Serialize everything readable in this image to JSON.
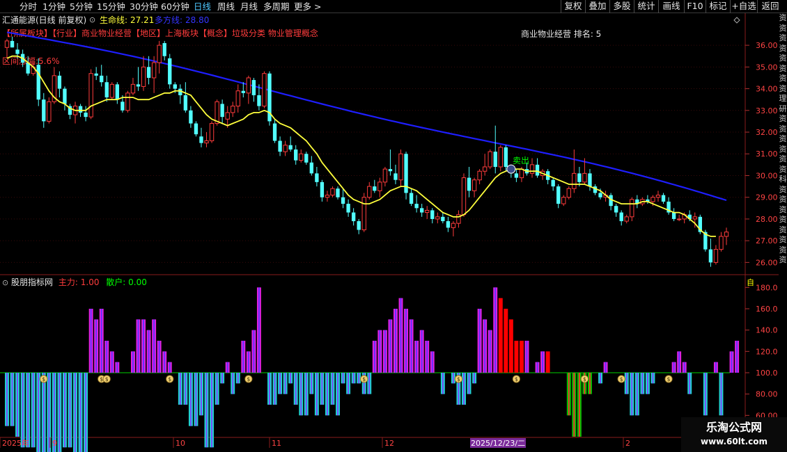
{
  "toolbar": {
    "periods": [
      {
        "label": "分时"
      },
      {
        "label": "1分钟"
      },
      {
        "label": "5分钟"
      },
      {
        "label": "15分钟"
      },
      {
        "label": "30分钟"
      },
      {
        "label": "60分钟"
      },
      {
        "label": "日线",
        "active": true
      },
      {
        "label": "周线"
      },
      {
        "label": "月线"
      },
      {
        "label": "多周期"
      },
      {
        "label": "更多 >"
      }
    ],
    "right_buttons": [
      "复权",
      "叠加",
      "多股",
      "统计",
      "画线",
      "F10",
      "标记",
      "+自选",
      "返回"
    ]
  },
  "main_panel": {
    "title": "汇通能源(日线 前复权)",
    "life_line_label": "生命线:",
    "life_line_value": "27.21",
    "bull_line_label": "多方线:",
    "bull_line_value": "28.80",
    "tags_line": "【所属板块】【行业】商业物业经营【地区】上海板块【概念】垃圾分类 物业管理概念",
    "pct_text": "区间涨幅:5.6%",
    "sector_rank": "商业物业经营 排名: 5",
    "sell_label": "卖出",
    "y_ticks": [
      "36.00",
      "35.00",
      "34.00",
      "33.00",
      "32.00",
      "31.00",
      "30.00",
      "29.00",
      "28.00",
      "27.00",
      "26.00"
    ]
  },
  "sub_panel": {
    "title": "股朋指标网",
    "main_force_label": "主力: 1.00",
    "retail_label": "散户: 0.00",
    "y_ticks": [
      "180.0",
      "160.0",
      "140.0",
      "120.0",
      "100.0",
      "80.00",
      "60.00"
    ],
    "yellow_marker": "自"
  },
  "x_axis": {
    "labels": [
      "2025年",
      "9",
      "10",
      "11",
      "12",
      "2025/12/23/二",
      "2"
    ]
  },
  "right_strip_text": "资资资资资资资资理研资资资资资资科资资资资资资资资",
  "watermark": {
    "title": "乐淘公式网",
    "url": "www.60lt.com"
  },
  "colors": {
    "up": "#ff3c3c",
    "down": "#52ffff",
    "life_line": "#ffff3c",
    "bull_line": "#1e1eff",
    "bar_magenta": "#e020e0",
    "bar_red": "#ff0000",
    "bar_cyan": "#20d0d0",
    "bar_green": "#00c000"
  },
  "chart_data": {
    "type": "candlestick",
    "ylim": [
      25.5,
      36.9
    ],
    "candles": [
      [
        35.9,
        36.3,
        35.4,
        36.2
      ],
      [
        36.2,
        36.4,
        35.9,
        35.9
      ],
      [
        35.8,
        36.1,
        35.4,
        35.6
      ],
      [
        35.6,
        35.8,
        35.0,
        35.2
      ],
      [
        35.2,
        35.5,
        34.6,
        34.7
      ],
      [
        34.7,
        35.2,
        34.6,
        35.0
      ],
      [
        35.1,
        35.4,
        33.2,
        33.5
      ],
      [
        33.5,
        33.8,
        32.2,
        32.5
      ],
      [
        32.5,
        33.6,
        32.4,
        33.4
      ],
      [
        33.4,
        35.0,
        33.3,
        34.6
      ],
      [
        34.6,
        34.8,
        33.6,
        34.0
      ],
      [
        34.0,
        34.1,
        33.0,
        33.3
      ],
      [
        33.2,
        33.3,
        32.6,
        32.8
      ],
      [
        32.8,
        33.4,
        32.4,
        33.2
      ],
      [
        33.2,
        33.3,
        32.7,
        32.9
      ],
      [
        32.9,
        33.2,
        32.5,
        32.7
      ],
      [
        32.7,
        34.9,
        32.6,
        34.7
      ],
      [
        34.7,
        35.0,
        34.4,
        34.6
      ],
      [
        34.6,
        35.1,
        34.1,
        34.3
      ],
      [
        34.3,
        34.6,
        33.4,
        33.6
      ],
      [
        33.6,
        34.3,
        33.5,
        34.2
      ],
      [
        34.2,
        34.3,
        33.3,
        33.5
      ],
      [
        33.4,
        33.7,
        32.9,
        33.0
      ],
      [
        33.0,
        33.9,
        32.9,
        33.8
      ],
      [
        33.8,
        34.5,
        33.7,
        34.2
      ],
      [
        34.2,
        35.0,
        33.9,
        34.1
      ],
      [
        34.1,
        35.5,
        33.9,
        35.0
      ],
      [
        35.0,
        35.5,
        34.2,
        34.5
      ],
      [
        34.5,
        35.5,
        33.8,
        35.2
      ],
      [
        35.2,
        36.2,
        34.7,
        36.0
      ],
      [
        36.1,
        36.2,
        35.3,
        35.5
      ],
      [
        35.4,
        35.6,
        34.0,
        34.2
      ],
      [
        34.2,
        34.3,
        33.8,
        34.0
      ],
      [
        34.0,
        34.2,
        33.3,
        33.7
      ],
      [
        33.7,
        34.3,
        32.9,
        33.0
      ],
      [
        33.0,
        33.2,
        32.2,
        32.4
      ],
      [
        32.4,
        32.5,
        31.8,
        31.9
      ],
      [
        31.8,
        32.2,
        31.3,
        31.5
      ],
      [
        31.5,
        32.0,
        31.3,
        31.6
      ],
      [
        31.6,
        32.5,
        31.5,
        32.4
      ],
      [
        32.4,
        33.5,
        32.3,
        33.4
      ],
      [
        33.3,
        33.5,
        32.4,
        32.7
      ],
      [
        32.6,
        33.2,
        32.2,
        32.9
      ],
      [
        32.9,
        33.4,
        32.7,
        33.2
      ],
      [
        33.2,
        34.2,
        32.9,
        33.9
      ],
      [
        33.9,
        34.3,
        33.6,
        33.8
      ],
      [
        33.8,
        34.6,
        33.3,
        34.5
      ],
      [
        34.4,
        34.5,
        33.4,
        33.7
      ],
      [
        33.7,
        34.2,
        33.0,
        33.2
      ],
      [
        33.2,
        34.8,
        33.1,
        34.7
      ],
      [
        34.7,
        34.8,
        32.3,
        32.5
      ],
      [
        32.4,
        32.6,
        31.5,
        31.6
      ],
      [
        31.6,
        31.8,
        30.9,
        31.1
      ],
      [
        31.1,
        31.6,
        30.9,
        31.4
      ],
      [
        31.4,
        31.8,
        31.1,
        31.2
      ],
      [
        31.2,
        31.4,
        30.5,
        30.7
      ],
      [
        30.7,
        31.2,
        30.6,
        31.0
      ],
      [
        31.0,
        31.1,
        30.5,
        30.6
      ],
      [
        30.6,
        30.9,
        30.0,
        30.1
      ],
      [
        30.1,
        30.4,
        29.5,
        29.7
      ],
      [
        29.7,
        29.8,
        28.8,
        29.0
      ],
      [
        29.0,
        29.3,
        28.8,
        29.1
      ],
      [
        29.1,
        29.5,
        29.0,
        29.4
      ],
      [
        29.4,
        29.5,
        28.9,
        29.0
      ],
      [
        29.0,
        29.4,
        28.5,
        28.7
      ],
      [
        28.7,
        28.9,
        28.1,
        28.3
      ],
      [
        28.3,
        28.5,
        27.7,
        27.9
      ],
      [
        27.9,
        28.0,
        27.3,
        27.5
      ],
      [
        27.5,
        29.2,
        27.4,
        29.0
      ],
      [
        29.0,
        29.7,
        28.9,
        29.5
      ],
      [
        29.5,
        29.8,
        29.2,
        29.3
      ],
      [
        29.3,
        29.9,
        29.0,
        29.7
      ],
      [
        29.7,
        30.4,
        29.5,
        30.3
      ],
      [
        30.3,
        31.2,
        30.0,
        30.2
      ],
      [
        30.1,
        30.5,
        29.6,
        29.8
      ],
      [
        29.8,
        31.2,
        29.5,
        31.0
      ],
      [
        31.0,
        31.1,
        28.9,
        29.2
      ],
      [
        29.2,
        29.4,
        28.6,
        28.7
      ],
      [
        28.7,
        29.1,
        28.3,
        28.5
      ],
      [
        28.5,
        28.7,
        28.1,
        28.3
      ],
      [
        28.3,
        28.6,
        28.0,
        28.4
      ],
      [
        28.4,
        28.5,
        27.8,
        28.0
      ],
      [
        28.0,
        28.3,
        27.8,
        28.1
      ],
      [
        28.1,
        28.3,
        27.8,
        27.9
      ],
      [
        27.9,
        28.1,
        27.4,
        27.6
      ],
      [
        27.6,
        27.9,
        27.2,
        27.8
      ],
      [
        27.8,
        28.4,
        27.6,
        28.2
      ],
      [
        28.2,
        30.1,
        28.1,
        29.9
      ],
      [
        29.9,
        30.4,
        29.0,
        29.3
      ],
      [
        29.3,
        29.9,
        29.0,
        29.8
      ],
      [
        29.8,
        30.3,
        29.6,
        30.2
      ],
      [
        30.2,
        31.0,
        30.0,
        30.4
      ],
      [
        30.4,
        31.2,
        30.3,
        31.1
      ],
      [
        31.1,
        32.3,
        30.1,
        30.4
      ],
      [
        30.4,
        31.4,
        30.2,
        31.3
      ],
      [
        31.3,
        31.4,
        30.2,
        30.4
      ],
      [
        30.4,
        30.5,
        29.9,
        30.1
      ],
      [
        30.1,
        30.3,
        29.7,
        29.9
      ],
      [
        29.9,
        30.4,
        29.7,
        30.3
      ],
      [
        30.3,
        30.6,
        30.0,
        30.1
      ],
      [
        30.1,
        30.8,
        29.9,
        30.5
      ],
      [
        30.5,
        30.8,
        29.9,
        30.0
      ],
      [
        30.0,
        30.3,
        29.8,
        30.2
      ],
      [
        30.2,
        30.3,
        29.6,
        29.8
      ],
      [
        29.8,
        29.9,
        29.3,
        29.5
      ],
      [
        29.5,
        29.6,
        28.5,
        28.7
      ],
      [
        28.7,
        29.1,
        28.6,
        29.0
      ],
      [
        29.0,
        29.5,
        28.9,
        29.4
      ],
      [
        29.4,
        31.2,
        29.2,
        30.1
      ],
      [
        30.1,
        30.4,
        29.5,
        29.7
      ],
      [
        29.7,
        30.8,
        29.6,
        30.1
      ],
      [
        30.1,
        30.3,
        29.3,
        29.5
      ],
      [
        29.5,
        29.6,
        29.1,
        29.2
      ],
      [
        29.2,
        29.4,
        28.9,
        29.0
      ],
      [
        29.0,
        29.3,
        28.8,
        29.1
      ],
      [
        29.1,
        29.2,
        28.4,
        28.6
      ],
      [
        28.6,
        28.7,
        28.1,
        28.3
      ],
      [
        28.3,
        28.4,
        27.7,
        27.9
      ],
      [
        27.9,
        28.2,
        27.8,
        28.1
      ],
      [
        28.1,
        29.0,
        27.9,
        28.9
      ],
      [
        28.9,
        29.1,
        28.5,
        28.7
      ],
      [
        28.7,
        29.0,
        28.6,
        28.9
      ],
      [
        28.9,
        29.1,
        28.7,
        28.8
      ],
      [
        28.8,
        29.1,
        28.6,
        29.0
      ],
      [
        29.0,
        29.3,
        28.8,
        29.1
      ],
      [
        29.1,
        29.2,
        28.7,
        28.8
      ],
      [
        28.8,
        29.0,
        28.2,
        28.3
      ],
      [
        28.3,
        28.5,
        27.9,
        28.0
      ],
      [
        28.0,
        28.2,
        27.9,
        28.0
      ],
      [
        28.0,
        28.3,
        27.8,
        28.2
      ],
      [
        28.2,
        28.4,
        27.9,
        28.0
      ],
      [
        28.0,
        28.3,
        27.6,
        28.1
      ],
      [
        28.1,
        28.2,
        27.3,
        27.4
      ],
      [
        27.4,
        27.5,
        26.5,
        26.6
      ],
      [
        26.6,
        27.1,
        25.8,
        26.0
      ],
      [
        26.0,
        26.8,
        25.9,
        26.6
      ],
      [
        26.6,
        27.4,
        26.5,
        27.2
      ],
      [
        27.2,
        27.6,
        26.8,
        27.4
      ]
    ],
    "life_line": [
      35.4,
      35.5,
      35.5,
      35.4,
      35.2,
      35.0,
      34.7,
      34.3,
      33.9,
      33.6,
      33.4,
      33.3,
      33.1,
      33.0,
      33.0,
      33.0,
      33.2,
      33.3,
      33.4,
      33.5,
      33.5,
      33.5,
      33.6,
      33.6,
      33.6,
      33.5,
      33.5,
      33.5,
      33.6,
      33.7,
      33.8,
      33.8,
      33.9,
      33.9,
      33.8,
      33.7,
      33.4,
      33.1,
      32.8,
      32.6,
      32.5,
      32.4,
      32.3,
      32.4,
      32.5,
      32.6,
      32.8,
      32.9,
      32.9,
      33.0,
      32.9,
      32.6,
      32.4,
      32.3,
      32.2,
      32.0,
      31.8,
      31.6,
      31.3,
      31.0,
      30.6,
      30.3,
      30.0,
      29.7,
      29.4,
      29.1,
      28.9,
      28.8,
      28.7,
      28.7,
      28.8,
      28.9,
      29.1,
      29.3,
      29.4,
      29.5,
      29.5,
      29.4,
      29.3,
      29.1,
      28.9,
      28.7,
      28.5,
      28.3,
      28.2,
      28.1,
      28.1,
      28.2,
      28.4,
      28.7,
      29.0,
      29.3,
      29.6,
      29.9,
      30.1,
      30.2,
      30.3,
      30.3,
      30.3,
      30.2,
      30.2,
      30.2,
      30.1,
      30.0,
      29.9,
      29.8,
      29.7,
      29.6,
      29.6,
      29.6,
      29.6,
      29.5,
      29.4,
      29.3,
      29.1,
      28.9,
      28.8,
      28.7,
      28.7,
      28.7,
      28.7,
      28.8,
      28.8,
      28.7,
      28.6,
      28.5,
      28.4,
      28.3,
      28.3,
      28.2,
      28.0,
      27.8,
      27.5,
      27.3,
      27.2,
      27.2
    ],
    "bull_line": {
      "start": 36.6,
      "end": 28.8
    },
    "sub_indicator": [
      50,
      50,
      40,
      30,
      30,
      30,
      20,
      20,
      20,
      20,
      20,
      30,
      30,
      20,
      20,
      20,
      160,
      150,
      160,
      130,
      120,
      110,
      100,
      100,
      120,
      150,
      150,
      140,
      150,
      130,
      120,
      110,
      100,
      70,
      70,
      50,
      50,
      60,
      30,
      30,
      70,
      90,
      110,
      80,
      90,
      130,
      120,
      140,
      180,
      100,
      70,
      70,
      80,
      80,
      90,
      70,
      60,
      60,
      80,
      60,
      70,
      60,
      70,
      60,
      90,
      80,
      90,
      90,
      80,
      80,
      130,
      140,
      140,
      150,
      160,
      170,
      160,
      150,
      130,
      140,
      130,
      120,
      100,
      80,
      100,
      90,
      70,
      70,
      80,
      90,
      160,
      150,
      140,
      180,
      170,
      160,
      150,
      130,
      130,
      130,
      100,
      110,
      120,
      120,
      100,
      100,
      100,
      60,
      40,
      40,
      80,
      80,
      100,
      90,
      110,
      100,
      100,
      100,
      80,
      60,
      60,
      80,
      80,
      90,
      100,
      100,
      100,
      110,
      120,
      110,
      80,
      100,
      100,
      60,
      100,
      110,
      60,
      100,
      120,
      130
    ],
    "markers_at": [
      7,
      18,
      19,
      31,
      46,
      68,
      86,
      97,
      110,
      117,
      126
    ]
  }
}
